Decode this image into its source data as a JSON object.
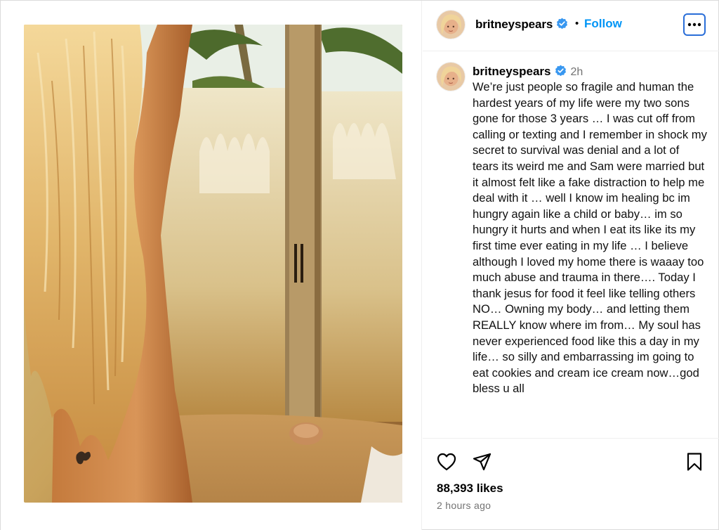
{
  "post": {
    "username": "britneyspears",
    "verified": true,
    "separator": "•",
    "follow_label": "Follow",
    "more_icon": "more-options-icon"
  },
  "caption": {
    "username": "britneyspears",
    "time": "2h",
    "text": "We’re just people so fragile and human the hardest years of my life were my two sons gone for those 3 years … I was cut off from calling or texting and I remember in shock my secret to survival was denial and a lot of tears its weird me and Sam were married but it almost felt like a fake distraction to help me deal with it … well I know im healing bc im hungry again like a child or baby… im so hungry it hurts and when I eat its like its my first time ever eating in my life … I believe although I loved my home there is waaay too much abuse and trauma in there…. Today I thank jesus for food it feel like telling others NO… Owning my body… and letting them REALLY know where im from… My soul has never experienced food like this a day in my life… so silly and embarrassing im going to eat cookies and cream ice cream now…god bless u all"
  },
  "engagement": {
    "likes": "88,393 likes",
    "posted": "2 hours ago"
  },
  "icons": {
    "like": "heart-icon",
    "share": "send-icon",
    "save": "bookmark-icon",
    "verified": "verified-badge-icon"
  },
  "colors": {
    "link_blue": "#0095f6",
    "verified_blue": "#3897f0",
    "muted": "#737373",
    "divider": "#efefef"
  }
}
